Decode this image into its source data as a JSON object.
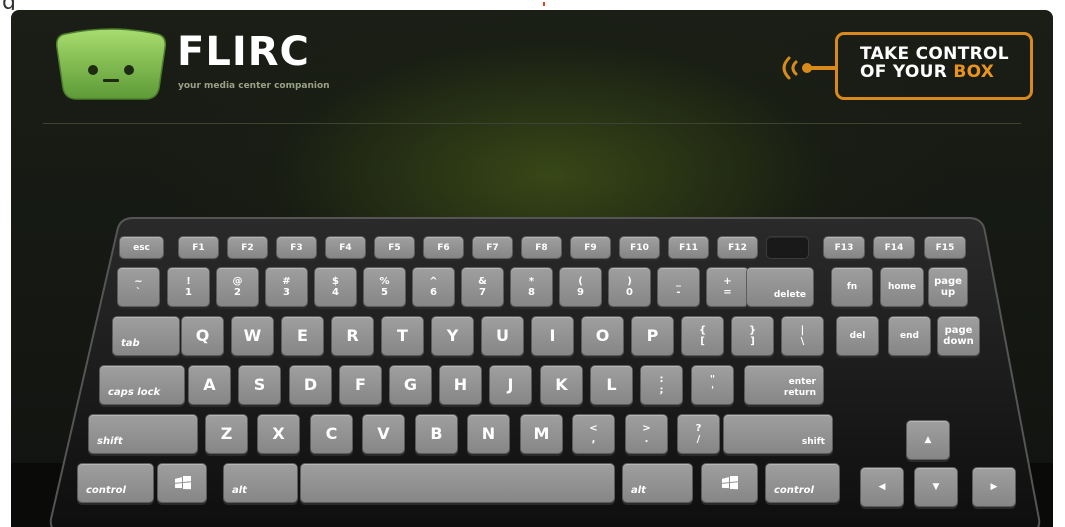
{
  "header": {
    "brand": "FLIRC",
    "tagline": "your media center companion",
    "promo_line1": "TAKE CONTROL",
    "promo_line2_prefix": "OF YOUR ",
    "promo_line2_accent": "BOX"
  },
  "colors": {
    "accent": "#d88a1c",
    "logo_green": "#7ab94a",
    "key_face": "#919191",
    "background": "#15170f"
  },
  "keyboard": {
    "function_row": [
      "esc",
      "F1",
      "F2",
      "F3",
      "F4",
      "F5",
      "F6",
      "F7",
      "F8",
      "F9",
      "F10",
      "F11",
      "F12",
      "",
      "F13",
      "F14",
      "F15"
    ],
    "number_row": [
      {
        "top": "~",
        "bottom": "`"
      },
      {
        "top": "!",
        "bottom": "1"
      },
      {
        "top": "@",
        "bottom": "2"
      },
      {
        "top": "#",
        "bottom": "3"
      },
      {
        "top": "$",
        "bottom": "4"
      },
      {
        "top": "%",
        "bottom": "5"
      },
      {
        "top": "^",
        "bottom": "6"
      },
      {
        "top": "&",
        "bottom": "7"
      },
      {
        "top": "*",
        "bottom": "8"
      },
      {
        "top": "(",
        "bottom": "9"
      },
      {
        "top": ")",
        "bottom": "0"
      },
      {
        "top": "_",
        "bottom": "-"
      },
      {
        "top": "+",
        "bottom": "="
      }
    ],
    "delete": "delete",
    "fn": "fn",
    "home": "home",
    "page_up": [
      "page",
      "up"
    ],
    "tab": "tab",
    "qwerty_row": [
      "Q",
      "W",
      "E",
      "R",
      "T",
      "Y",
      "U",
      "I",
      "O",
      "P"
    ],
    "brackets": [
      {
        "top": "{",
        "bottom": "["
      },
      {
        "top": "}",
        "bottom": "]"
      },
      {
        "top": "|",
        "bottom": "\\"
      }
    ],
    "del": "del",
    "end": "end",
    "page_down": [
      "page",
      "down"
    ],
    "caps_lock": "caps lock",
    "home_row": [
      "A",
      "S",
      "D",
      "F",
      "G",
      "H",
      "J",
      "K",
      "L"
    ],
    "home_punct": [
      {
        "top": ":",
        "bottom": ";"
      },
      {
        "top": "\"",
        "bottom": "'"
      }
    ],
    "enter": [
      "enter",
      "return"
    ],
    "shift": "shift",
    "bottom_letters": [
      "Z",
      "X",
      "C",
      "V",
      "B",
      "N",
      "M"
    ],
    "bottom_punct": [
      {
        "top": "<",
        "bottom": ","
      },
      {
        "top": ">",
        "bottom": "."
      },
      {
        "top": "?",
        "bottom": "/"
      }
    ],
    "control": "control",
    "alt": "alt",
    "arrows": {
      "up": "▲",
      "left": "◀",
      "down": "▼",
      "right": "▶"
    }
  }
}
